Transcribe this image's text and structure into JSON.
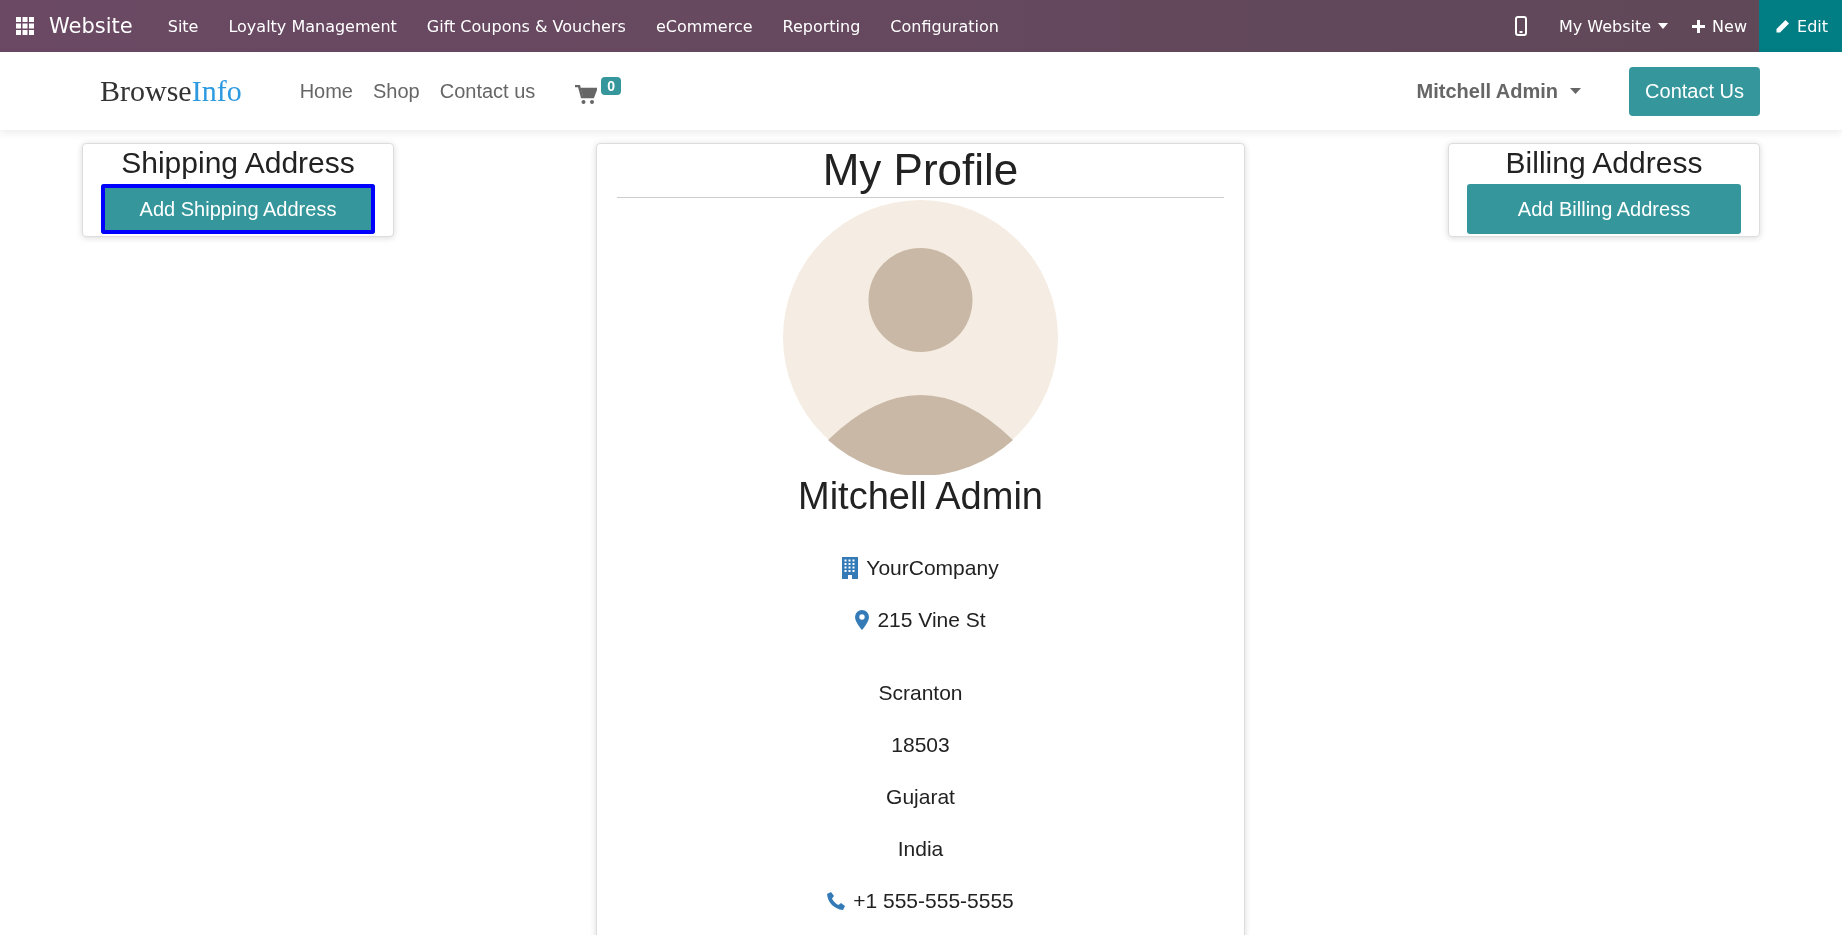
{
  "top_bar": {
    "app_name": "Website",
    "menu": [
      "Site",
      "Loyalty Management",
      "Gift Coupons & Vouchers",
      "eCommerce",
      "Reporting",
      "Configuration"
    ],
    "website_switcher": "My Website",
    "new_button": "New",
    "edit_button": "Edit"
  },
  "navbar": {
    "logo": {
      "dark_part": "Browse",
      "light_part": "Info"
    },
    "links": [
      "Home",
      "Shop",
      "Contact us"
    ],
    "cart_count": "0",
    "user_menu": "Mitchell Admin",
    "cta_button": "Contact Us"
  },
  "shipping_card": {
    "title": "Shipping Address",
    "button": {
      "label": "Add Shipping Address",
      "focused": true
    }
  },
  "profile": {
    "title": "My Profile",
    "name": "Mitchell Admin",
    "details": [
      {
        "kind": "company",
        "text": "YourCompany"
      },
      {
        "kind": "address",
        "text": "215 Vine St"
      },
      {
        "kind": "plain",
        "text": "Scranton"
      },
      {
        "kind": "plain",
        "text": "18503"
      },
      {
        "kind": "plain",
        "text": "Gujarat"
      },
      {
        "kind": "plain",
        "text": "India"
      },
      {
        "kind": "phone",
        "text": "+1 555-555-5555"
      }
    ]
  },
  "billing_card": {
    "title": "Billing Address",
    "button": {
      "label": "Add Billing Address",
      "focused": false
    }
  }
}
